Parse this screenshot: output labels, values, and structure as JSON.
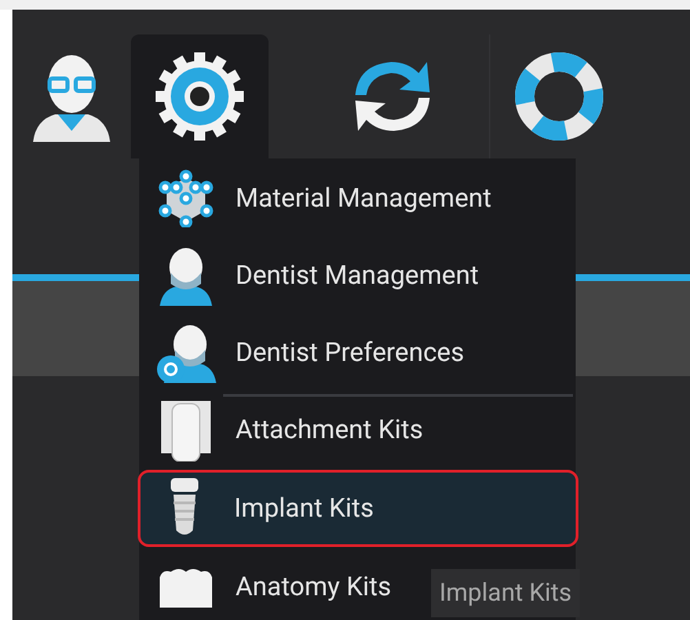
{
  "toolbar": [
    {
      "kind": "user",
      "selected": false
    },
    {
      "kind": "settings",
      "selected": true
    },
    {
      "kind": "sync",
      "selected": false
    },
    {
      "kind": "help",
      "selected": false
    }
  ],
  "menu": {
    "items": [
      {
        "kind": "material",
        "label": "Material Management",
        "highlighted": false,
        "divider_before": false
      },
      {
        "kind": "dentist",
        "label": "Dentist Management",
        "highlighted": false,
        "divider_before": false
      },
      {
        "kind": "preferences",
        "label": "Dentist Preferences",
        "highlighted": false,
        "divider_before": false
      },
      {
        "kind": "attachment",
        "label": "Attachment Kits",
        "highlighted": false,
        "divider_before": true
      },
      {
        "kind": "implant",
        "label": "Implant Kits",
        "highlighted": true,
        "divider_before": false
      },
      {
        "kind": "anatomy",
        "label": "Anatomy Kits",
        "highlighted": false,
        "divider_before": false
      }
    ]
  },
  "tooltip": "Implant Kits"
}
